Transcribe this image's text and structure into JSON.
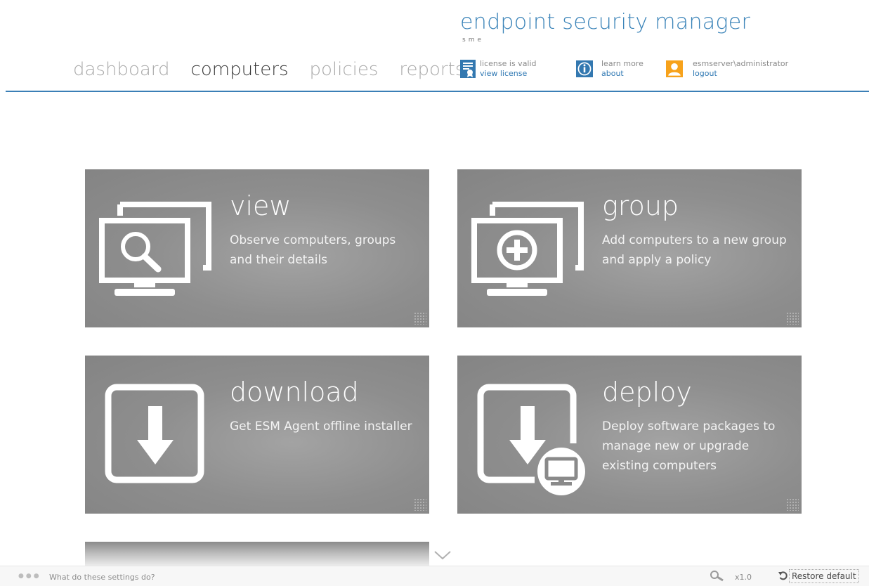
{
  "header": {
    "brand": "endpoint security manager",
    "brand_sub": "sme",
    "nav": [
      "dashboard",
      "computers",
      "policies",
      "reports"
    ],
    "active_nav": "computers",
    "license": {
      "status": "license is valid",
      "link": "view license"
    },
    "about": {
      "top": "learn more",
      "link": "about"
    },
    "user": {
      "name": "esmserver\\administrator",
      "link": "logout"
    },
    "colors": {
      "accent": "#3a83b8",
      "user_icon": "#f7a21b",
      "license_icon": "#3378b0"
    }
  },
  "tiles": [
    {
      "title": "view",
      "description": "Observe computers, groups and their details",
      "icon": "monitor-search-icon"
    },
    {
      "title": "group",
      "description": "Add computers to a new group and apply a policy",
      "icon": "monitor-add-icon"
    },
    {
      "title": "download",
      "description": "Get ESM Agent offline installer",
      "icon": "download-icon"
    },
    {
      "title": "deploy",
      "description": "Deploy software packages to manage new or upgrade existing computers",
      "icon": "deploy-icon"
    }
  ],
  "status_bar": {
    "help": "What do these settings do?",
    "zoom": "x1.0",
    "restore": "Restore default"
  }
}
